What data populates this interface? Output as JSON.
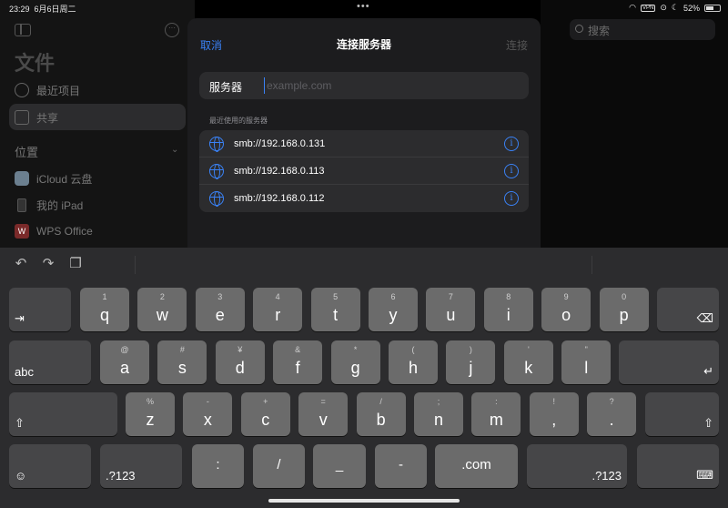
{
  "status": {
    "time": "23:29",
    "date": "6月6日周二",
    "vpn": "VPN",
    "battery": "52%"
  },
  "sidebar": {
    "title": "文件",
    "recent": "最近项目",
    "shared": "共享",
    "section": "位置",
    "locations": [
      "iCloud 云盘",
      "我的 iPad",
      "WPS Office"
    ]
  },
  "background": {
    "search_placeholder": "搜索"
  },
  "modal": {
    "cancel": "取消",
    "title": "连接服务器",
    "connect": "连接",
    "server_label": "服务器",
    "server_placeholder": "example.com",
    "recent_header": "最近使用的服务器",
    "recent": [
      "smb://192.168.0.131",
      "smb://192.168.0.113",
      "smb://192.168.0.112"
    ]
  },
  "keyboard": {
    "row1": [
      [
        "1",
        "q"
      ],
      [
        "2",
        "w"
      ],
      [
        "3",
        "e"
      ],
      [
        "4",
        "r"
      ],
      [
        "5",
        "t"
      ],
      [
        "6",
        "y"
      ],
      [
        "7",
        "u"
      ],
      [
        "8",
        "i"
      ],
      [
        "9",
        "o"
      ],
      [
        "0",
        "p"
      ]
    ],
    "row2": [
      [
        "@",
        "a"
      ],
      [
        "#",
        "s"
      ],
      [
        "¥",
        "d"
      ],
      [
        "&",
        "f"
      ],
      [
        "*",
        "g"
      ],
      [
        "(",
        "h"
      ],
      [
        ")",
        "j"
      ],
      [
        "'",
        "k"
      ],
      [
        "\"",
        "l"
      ]
    ],
    "row3": [
      [
        "%",
        "z"
      ],
      [
        "-",
        "x"
      ],
      [
        "+",
        "c"
      ],
      [
        "=",
        "v"
      ],
      [
        "/",
        "b"
      ],
      [
        ";",
        "n"
      ],
      [
        ":",
        "m"
      ],
      [
        "!",
        ","
      ],
      [
        "?",
        "."
      ]
    ],
    "abc": "abc",
    "num": ".?123",
    "bottom": [
      ":",
      "/",
      "_",
      "-",
      ".com"
    ]
  }
}
